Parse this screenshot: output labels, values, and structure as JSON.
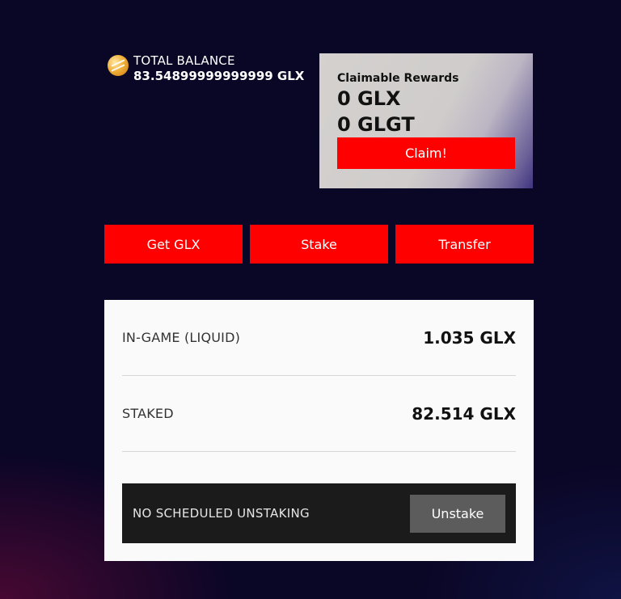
{
  "balance": {
    "label": "TOTAL BALANCE",
    "value": "83.54899999999999 GLX",
    "icon": "glx-coin-icon"
  },
  "claim": {
    "title": "Claimable Rewards",
    "glx": "0 GLX",
    "glgt": "0 GLGT",
    "button_label": "Claim!"
  },
  "actions": {
    "get_label": "Get GLX",
    "stake_label": "Stake",
    "transfer_label": "Transfer"
  },
  "panel": {
    "rows": [
      {
        "label": "IN-GAME (LIQUID)",
        "value": "1.035 GLX"
      },
      {
        "label": "STAKED",
        "value": "82.514 GLX"
      }
    ],
    "unstaking": {
      "label": "NO SCHEDULED UNSTAKING",
      "button_label": "Unstake"
    }
  },
  "colors": {
    "accent": "#ff0000",
    "background": "#0a0626",
    "panel": "#fafafa",
    "unstake_bar": "#1b1b1b"
  }
}
